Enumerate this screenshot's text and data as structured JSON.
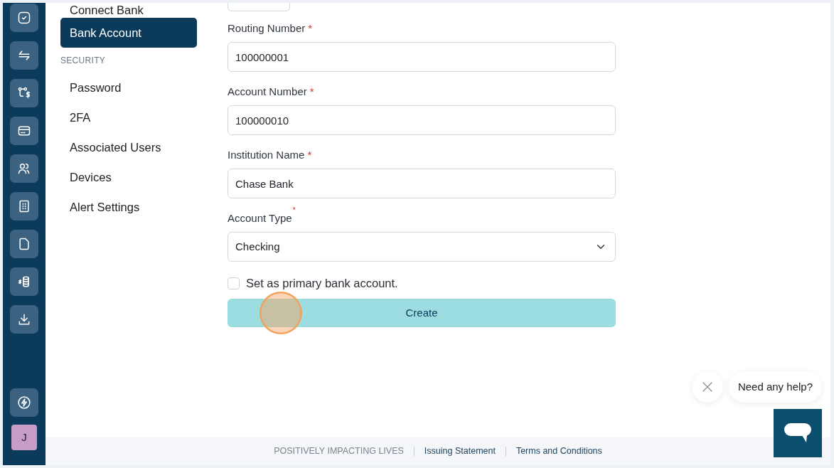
{
  "rail": {
    "avatar": "J"
  },
  "settings_nav": {
    "groups": [
      {
        "items": [
          {
            "label": "Connect Bank",
            "selected": false
          },
          {
            "label": "Bank Account",
            "selected": true
          }
        ]
      },
      {
        "heading": "SECURITY",
        "items": [
          {
            "label": "Password",
            "selected": false
          },
          {
            "label": "2FA",
            "selected": false
          },
          {
            "label": "Associated Users",
            "selected": false
          },
          {
            "label": "Devices",
            "selected": false
          },
          {
            "label": "Alert Settings",
            "selected": false
          }
        ]
      }
    ]
  },
  "form": {
    "fields": [
      {
        "kind": "text",
        "label": "Routing Number",
        "required_mark": "*",
        "mark_raised": false,
        "value": "100000001"
      },
      {
        "kind": "text",
        "label": "Account Number",
        "required_mark": "*",
        "mark_raised": false,
        "value": "100000010"
      },
      {
        "kind": "text",
        "label": "Institution Name",
        "required_mark": "*",
        "mark_raised": false,
        "value": "Chase Bank"
      },
      {
        "kind": "select",
        "label": "Account Type",
        "required_mark": "*",
        "mark_raised": true,
        "value": "Checking"
      }
    ],
    "checkbox": {
      "label": "Set as primary bank account.",
      "checked": false
    },
    "submit": "Create"
  },
  "help_widget": {
    "prompt": "Need any help?"
  },
  "footer": {
    "tagline": "POSITIVELY IMPACTING LIVES",
    "links": [
      "Issuing Statement",
      "Terms and Conditions"
    ]
  }
}
